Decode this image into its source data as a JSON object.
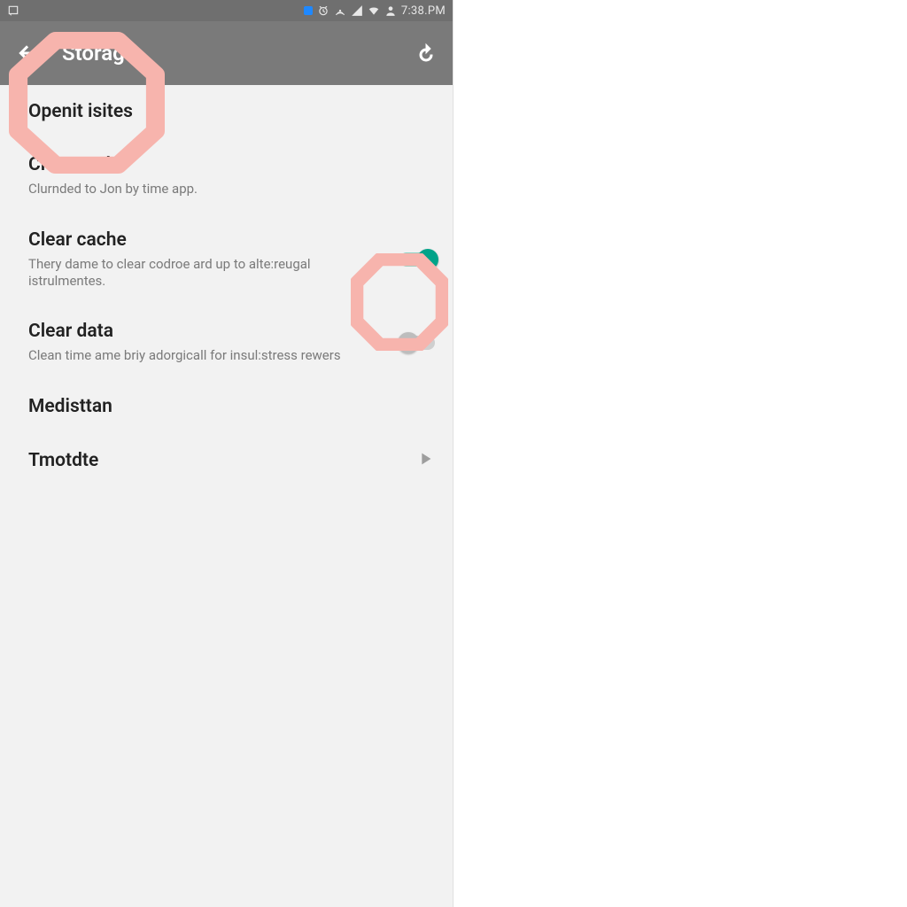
{
  "status_bar": {
    "time": "7:38.PM",
    "icons": {
      "notification": "notification-icon",
      "blue_dot": "blue-dot-icon",
      "alarm": "alarm-icon",
      "hotspot": "hotspot-icon",
      "signal": "signal-icon",
      "wifi": "wifi-icon",
      "account": "account-icon"
    }
  },
  "app_bar": {
    "title": "Storage",
    "back": "back-icon",
    "refresh": "refresh-icon"
  },
  "rows": {
    "open_sites": {
      "label": "Openit isites"
    },
    "clear_cache_1": {
      "label": "Clear cache",
      "sub": "Clurnded to Jon by time app."
    },
    "clear_cache_2": {
      "label": "Clear cache",
      "sub": "Thery dame to clear codroe ard up to alte:reugal istrulmentes.",
      "toggle_on": true
    },
    "clear_data": {
      "label": "Clear data",
      "sub": "Clean time ame briy adorgicall for insul:stress rewers",
      "toggle_on": false
    },
    "medisttan": {
      "label": "Medisttan"
    },
    "tmotdte": {
      "label": "Tmotdte"
    }
  },
  "highlights": {
    "marker1": "back-and-open-sites-highlight",
    "marker2": "clear-cache-toggle-highlight"
  },
  "colors": {
    "accent": "#00a389",
    "highlight": "#f7b4ad",
    "appbar": "#7a7a7a",
    "statusbar": "#6f6f6f",
    "sub_text": "#7a7a7a"
  }
}
